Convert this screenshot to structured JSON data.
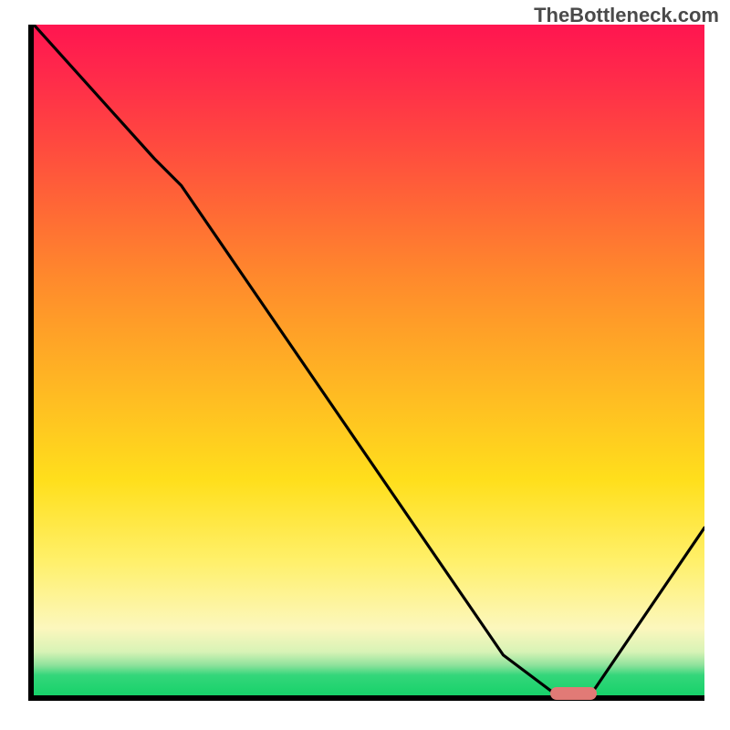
{
  "watermark": "TheBottleneck.com",
  "chart_data": {
    "type": "line",
    "title": "",
    "xlabel": "",
    "ylabel": "",
    "xlim": [
      0,
      100
    ],
    "ylim": [
      0,
      100
    ],
    "series": [
      {
        "name": "curve",
        "x": [
          0,
          18,
          22,
          70,
          78,
          83,
          100
        ],
        "y": [
          100,
          80,
          76,
          6,
          0,
          0,
          25
        ]
      }
    ],
    "marker_band": {
      "x_start": 77,
      "x_end": 84,
      "y": 0
    },
    "background_gradient": {
      "type": "vertical",
      "stops": [
        {
          "pos": 0,
          "color": "#ff1550"
        },
        {
          "pos": 0.18,
          "color": "#ff4a3f"
        },
        {
          "pos": 0.38,
          "color": "#ff8a2c"
        },
        {
          "pos": 0.58,
          "color": "#ffc321"
        },
        {
          "pos": 0.8,
          "color": "#fff06a"
        },
        {
          "pos": 0.93,
          "color": "#d8f3b6"
        },
        {
          "pos": 1.0,
          "color": "#17d26a"
        }
      ]
    }
  }
}
